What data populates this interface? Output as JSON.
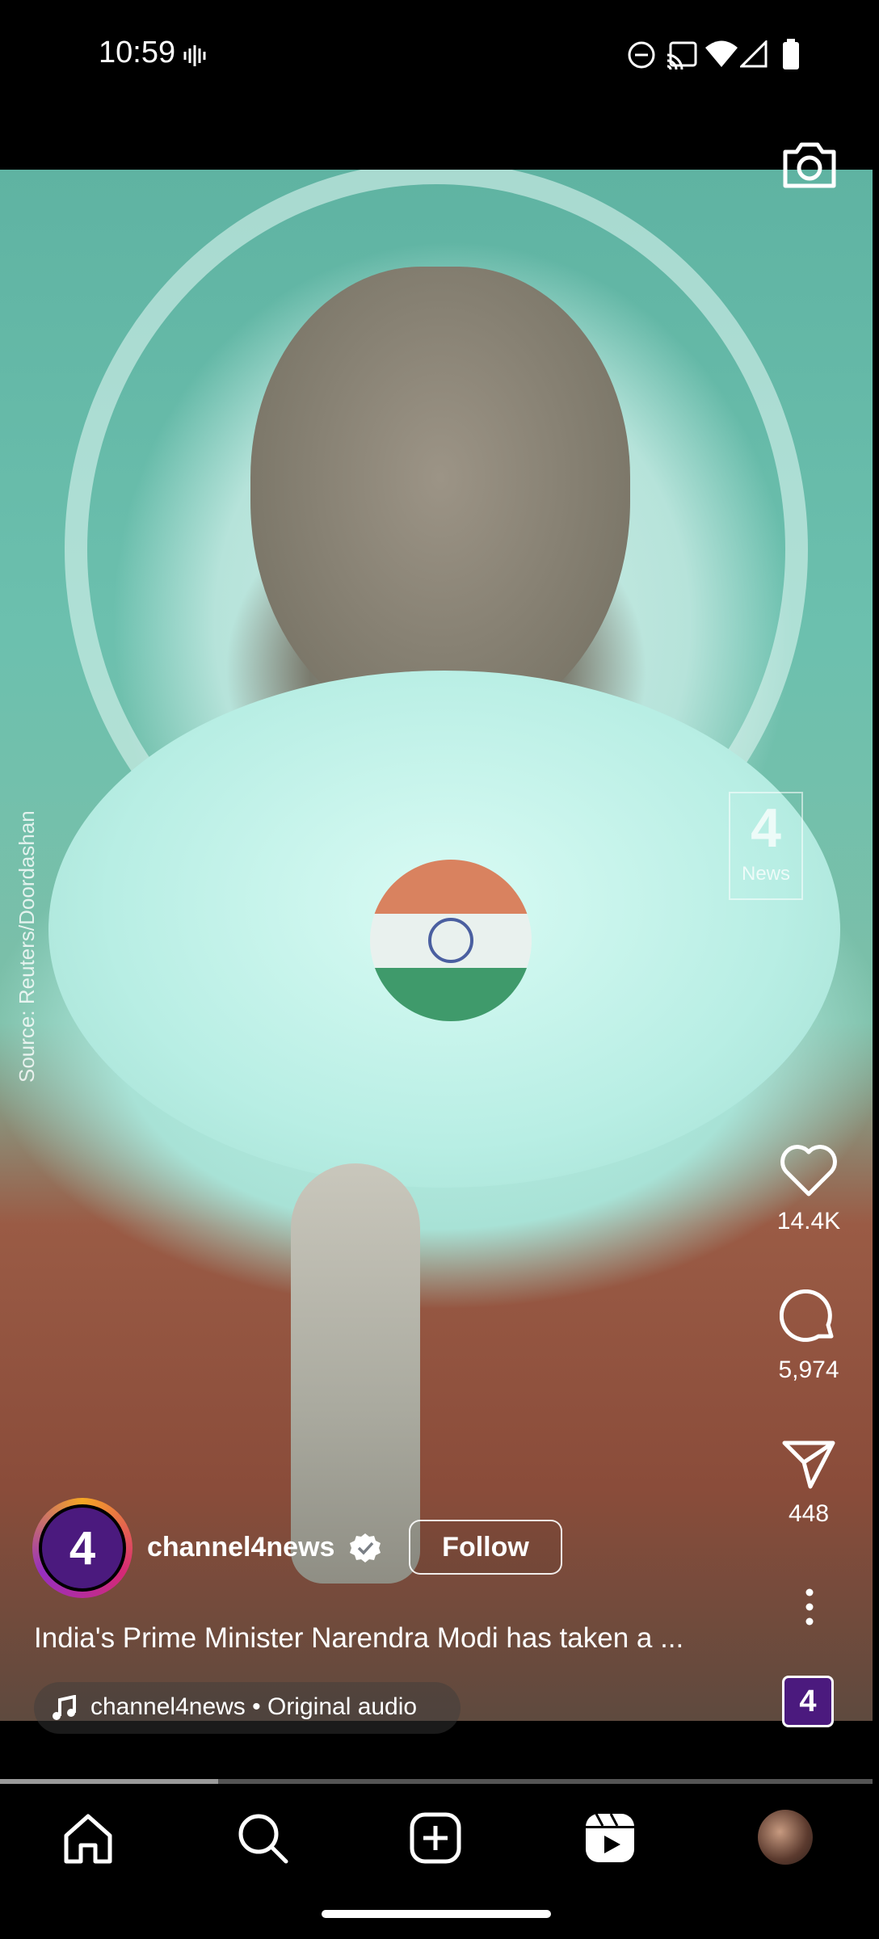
{
  "status_bar": {
    "time": "10:59",
    "icons": [
      "vibrate-icon",
      "do-not-disturb-icon",
      "cast-icon",
      "wifi-icon",
      "signal-icon",
      "battery-icon"
    ]
  },
  "video": {
    "source_watermark": "Source: Reuters/Doordashan",
    "channel_logo_text": "News",
    "channel_logo_glyph": "4"
  },
  "actions": {
    "like_count": "14.4K",
    "comment_count": "5,974",
    "share_count": "448"
  },
  "post": {
    "avatar_glyph": "4",
    "username": "channel4news",
    "follow_label": "Follow",
    "caption": "India's Prime Minister Narendra Modi has taken a ...",
    "audio": "channel4news • Original audio",
    "audio_thumb_glyph": "4"
  },
  "playback": {
    "progress_fraction": 0.25
  },
  "nav": {
    "items": [
      "home-icon",
      "search-icon",
      "create-icon",
      "reels-icon",
      "profile-avatar"
    ]
  },
  "colors": {
    "background": "#000000",
    "accent_purple": "#4b1a7e"
  }
}
